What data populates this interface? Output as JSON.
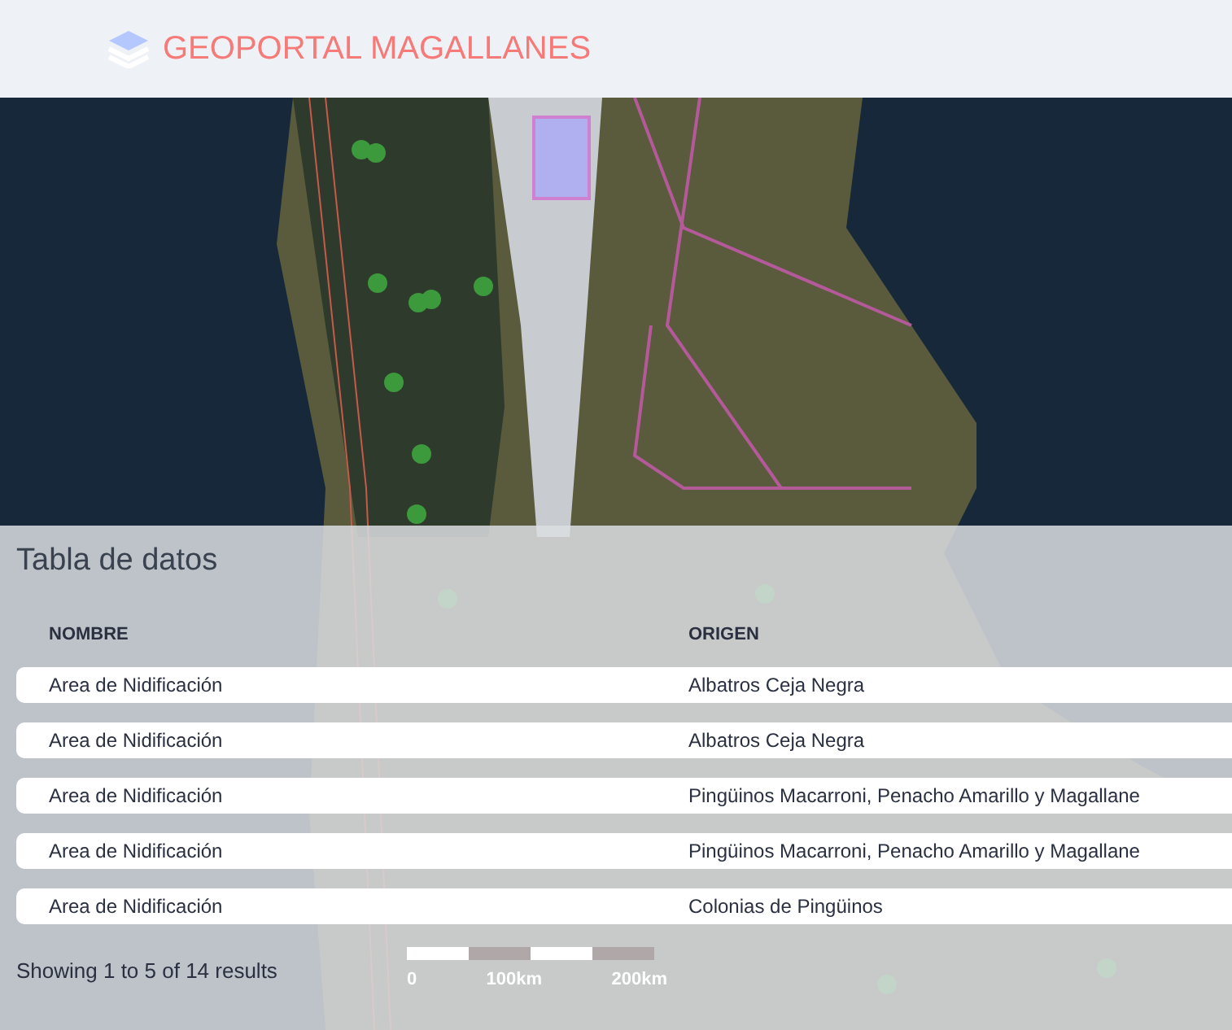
{
  "header": {
    "title": "GEOPORTAL MAGALLANES"
  },
  "table": {
    "title": "Tabla de datos",
    "columns": [
      "NOMBRE",
      "ORIGEN"
    ],
    "rows": [
      [
        "Area de Nidificación",
        "Albatros Ceja Negra"
      ],
      [
        "Area de Nidificación",
        "Albatros Ceja Negra"
      ],
      [
        "Area de Nidificación",
        "Pingüinos Macarroni, Penacho Amarillo y Magallane"
      ],
      [
        "Area de Nidificación",
        "Pingüinos Macarroni, Penacho Amarillo y Magallane"
      ],
      [
        "Area de Nidificación",
        "Colonias de Pingüinos"
      ]
    ],
    "summary": "Showing 1 to 5 of 14 results"
  },
  "scale_bar": {
    "labels": [
      "0",
      "100km",
      "200km"
    ]
  }
}
